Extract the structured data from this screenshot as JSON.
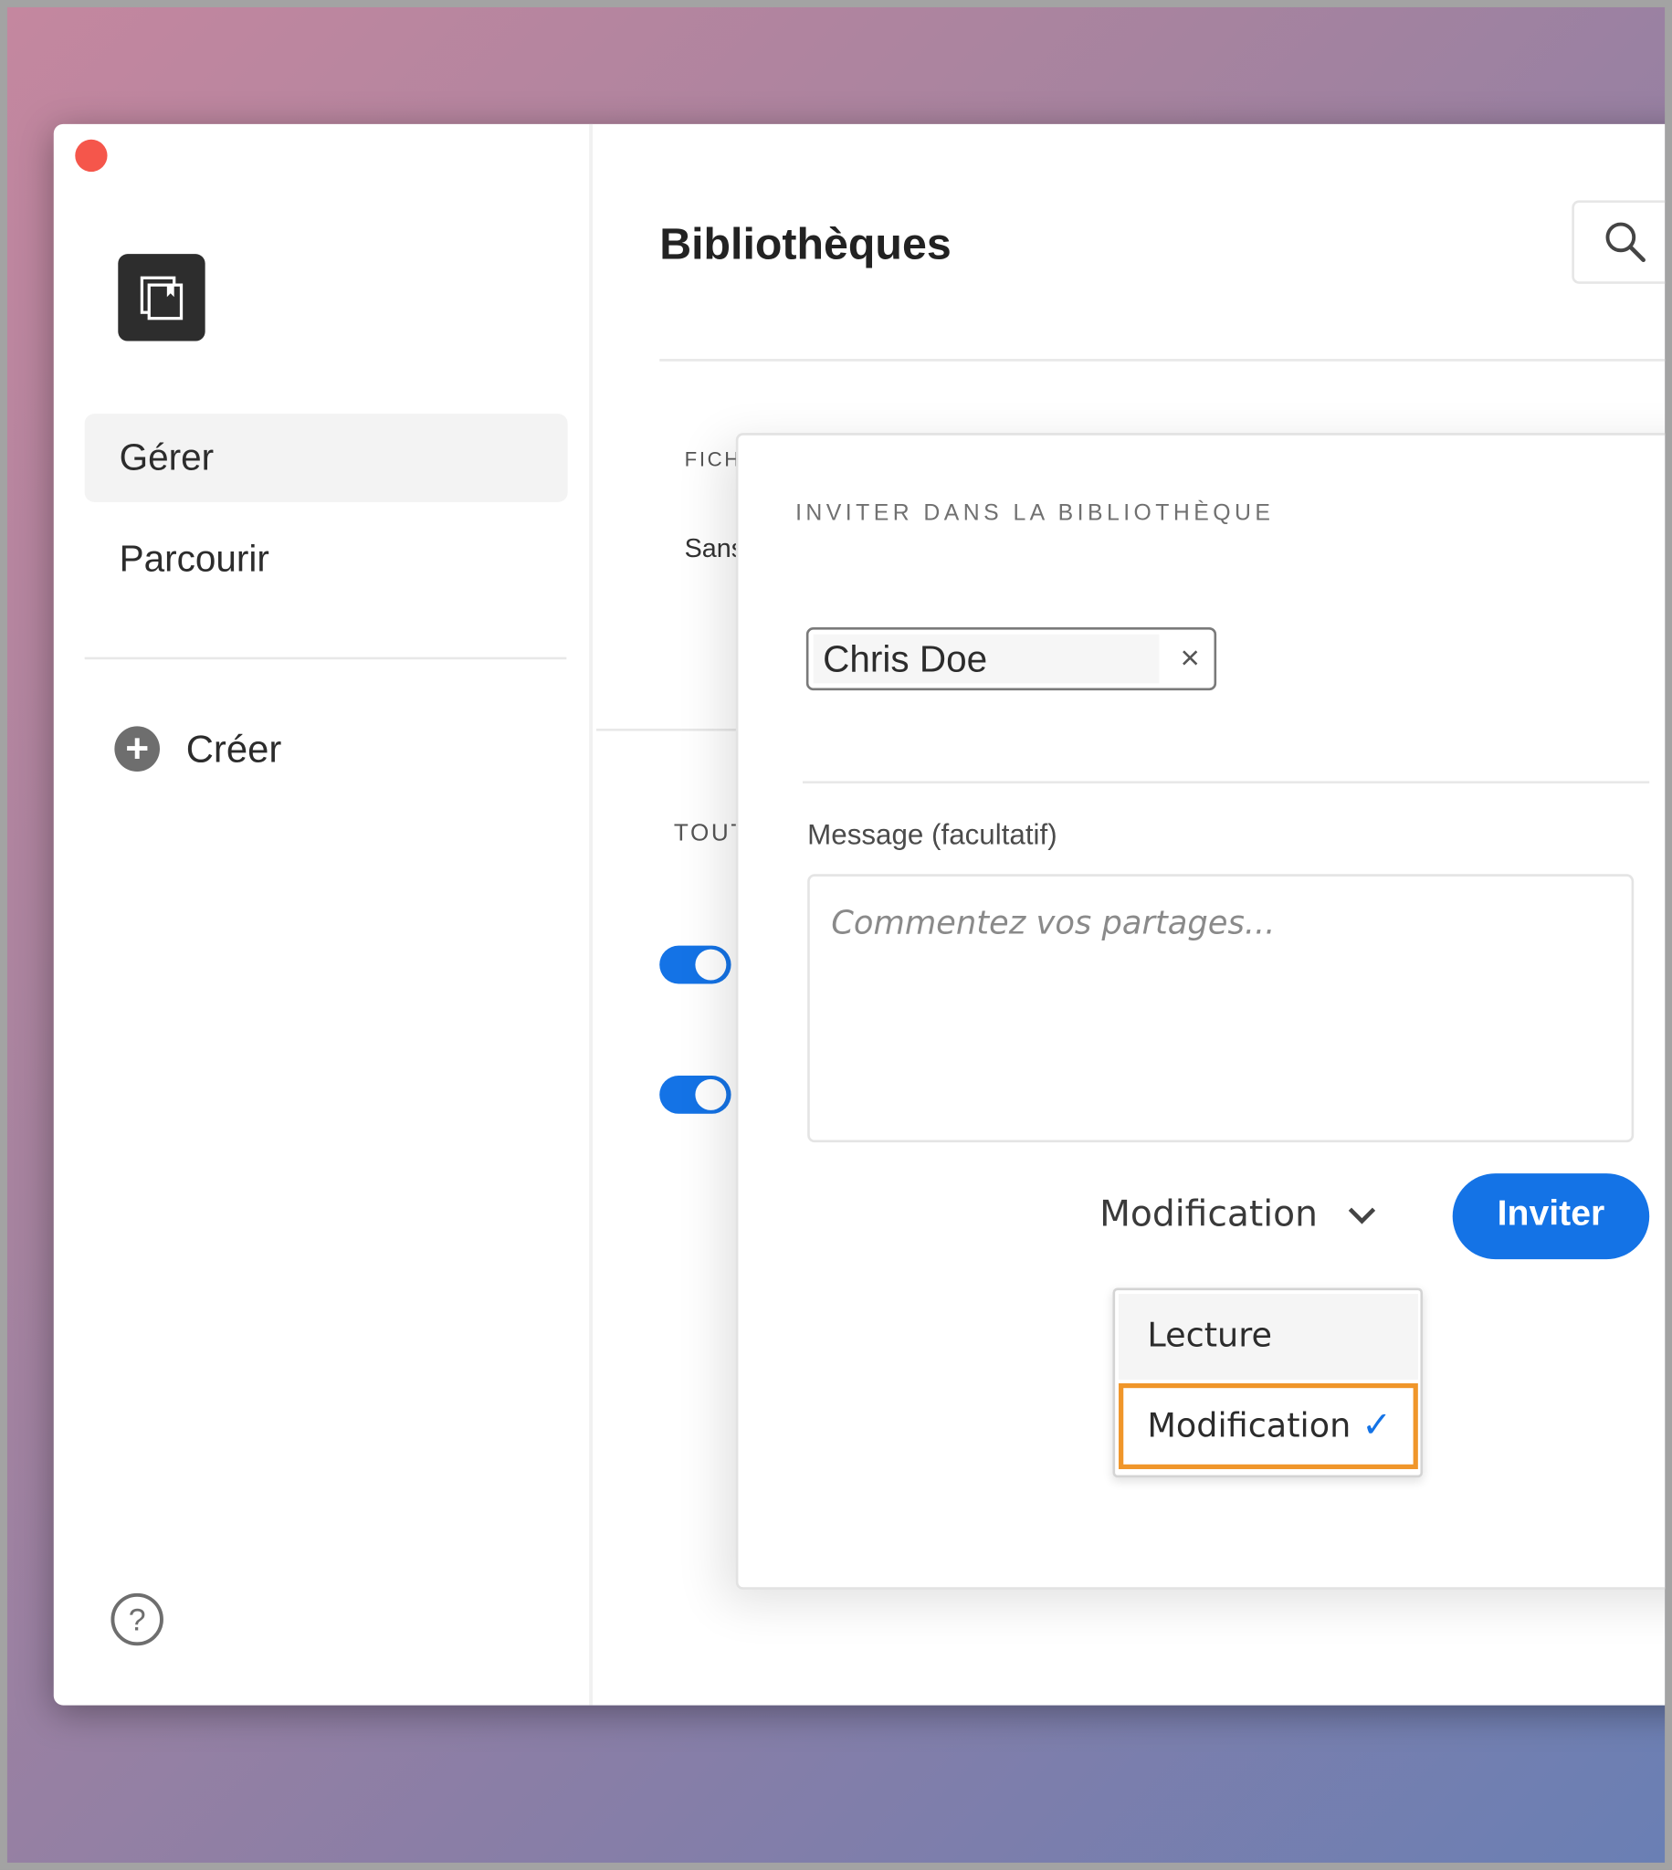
{
  "sidebar": {
    "items": [
      {
        "label": "Gérer",
        "selected": true
      },
      {
        "label": "Parcourir"
      }
    ],
    "create_label": "Créer",
    "help": "?"
  },
  "header": {
    "title": "Bibliothèques"
  },
  "background_content": {
    "section1": "FICH",
    "row1": "Sans",
    "section2": "TOUT"
  },
  "modal": {
    "title": "INVITER DANS LA BIBLIOTHÈQUE",
    "recipient": "Chris Doe",
    "remove_symbol": "×",
    "message_label": "Message (facultatif)",
    "message_placeholder": "Commentez vos partages...",
    "permission": "Modification",
    "invite_label": "Inviter",
    "menu": [
      {
        "label": "Lecture"
      },
      {
        "label": "Modification",
        "selected": true
      }
    ],
    "check": "✓"
  },
  "colors": {
    "accent": "#1473e6",
    "highlight": "#f0962a",
    "close": "#f5564b"
  }
}
